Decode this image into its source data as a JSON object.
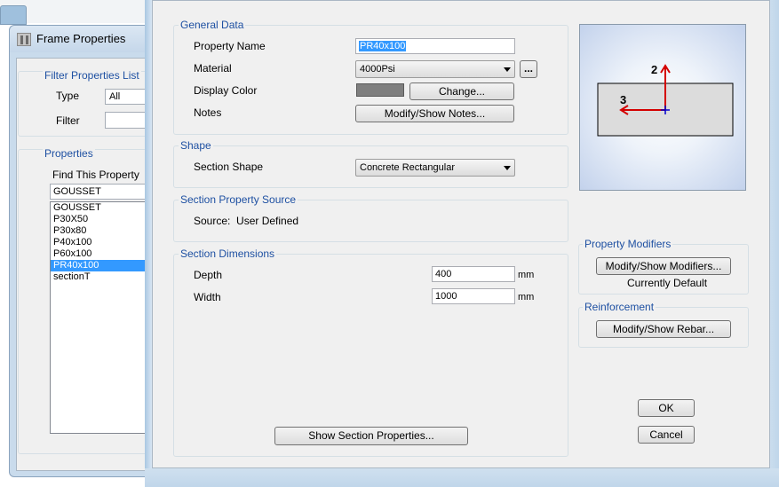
{
  "background_window": {
    "title": "Frame Properties",
    "filter_group_title": "Filter Properties List",
    "type_label": "Type",
    "type_value": "All",
    "filter_label": "Filter",
    "properties_group_title": "Properties",
    "find_label": "Find This Property",
    "find_value": "GOUSSET",
    "list_items": [
      "GOUSSET",
      "P30X50",
      "P30x80",
      "P40x100",
      "P60x100",
      "PR40x100",
      "sectionT"
    ],
    "selected_item": "PR40x100"
  },
  "dialog": {
    "general_data": {
      "title": "General Data",
      "property_name_label": "Property Name",
      "property_name_value": "PR40x100",
      "material_label": "Material",
      "material_value": "4000Psi",
      "ellipsis_label": "...",
      "display_color_label": "Display Color",
      "display_color": "#7f7f7f",
      "change_button": "Change...",
      "notes_label": "Notes",
      "notes_button": "Modify/Show Notes..."
    },
    "shape": {
      "title": "Shape",
      "section_shape_label": "Section Shape",
      "section_shape_value": "Concrete Rectangular"
    },
    "source": {
      "title": "Section Property Source",
      "source_text": "Source:  User Defined"
    },
    "dimensions": {
      "title": "Section Dimensions",
      "depth_label": "Depth",
      "depth_value": "400",
      "width_label": "Width",
      "width_value": "1000",
      "unit": "mm"
    },
    "preview": {
      "axis_2_label": "2",
      "axis_3_label": "3",
      "axis_color": "#d40000",
      "centroid_color": "#0000cc"
    },
    "modifiers": {
      "title": "Property Modifiers",
      "button": "Modify/Show Modifiers...",
      "status": "Currently Default"
    },
    "reinforcement": {
      "title": "Reinforcement",
      "button": "Modify/Show Rebar..."
    },
    "show_section_button": "Show Section Properties...",
    "ok_button": "OK",
    "cancel_button": "Cancel"
  }
}
